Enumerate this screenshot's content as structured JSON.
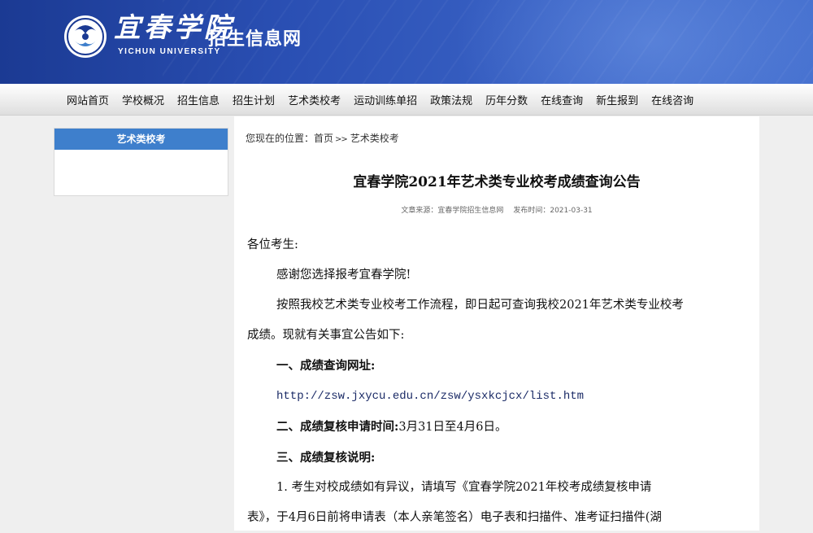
{
  "header": {
    "logo_script": "宜春学院",
    "logo_en": "YICHUN UNIVERSITY",
    "site_name": "招生信息网"
  },
  "nav": {
    "items": [
      "网站首页",
      "学校概况",
      "招生信息",
      "招生计划",
      "艺术类校考",
      "运动训练单招",
      "政策法规",
      "历年分数",
      "在线查询",
      "新生报到",
      "在线咨询"
    ]
  },
  "sidebar": {
    "title": "艺术类校考"
  },
  "breadcrumb": {
    "prefix": "您现在的位置：",
    "home": "首页",
    "separator": ">>",
    "current": "艺术类校考"
  },
  "article": {
    "title": "宜春学院2021年艺术类专业校考成绩查询公告",
    "source": "文章来源：宜春学院招生信息网",
    "date": "发布时间：2021-03-31",
    "salutation": "各位考生:",
    "p1": "感谢您选择报考宜春学院!",
    "p2_line1": "按照我校艺术类专业校考工作流程，即日起可查询我校2021年艺术类专业校考",
    "p2_line2": "成绩。现就有关事宜公告如下:",
    "h1": "一、成绩查询网址:",
    "url": "http://zsw.jxycu.edu.cn/zsw/ysxkcjcx/list.htm",
    "h2_label": "二、成绩复核申请时间:",
    "h2_value": "3月31日至4月6日。",
    "h3": "三、成绩复核说明:",
    "p3_line1": "1. 考生对校成绩如有异议，请填写《宜春学院2021年校考成绩复核申请",
    "p3_line2": "表》，于4月6日前将申请表（本人亲笔签名）电子表和扫描件、准考证扫描件(湖"
  }
}
